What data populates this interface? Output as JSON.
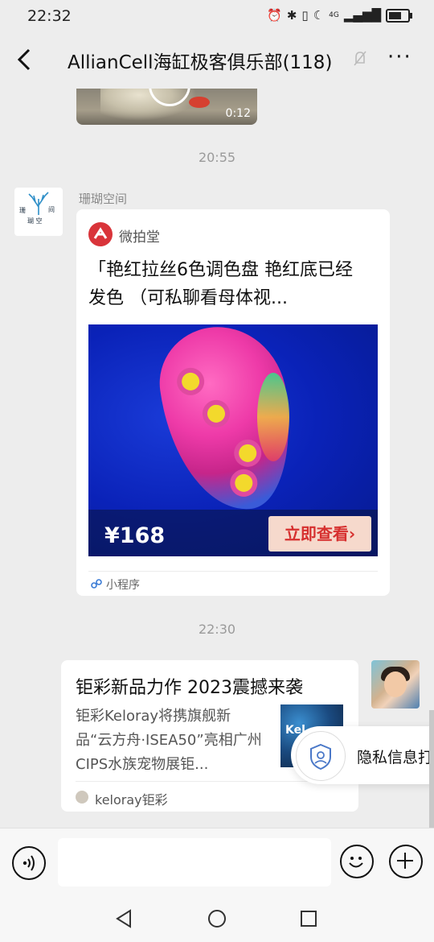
{
  "status_bar": {
    "time": "22:32",
    "network": "4G",
    "icons": [
      "alarm-icon",
      "bluetooth-icon",
      "vibrate-icon",
      "moon-icon",
      "signal-icon",
      "battery-icon"
    ]
  },
  "nav": {
    "title": "AllianCell海缸极客俱乐部(118)",
    "back_icon": "chevron-left-icon",
    "more_label": "···",
    "mute_icon": "bell-slash-icon"
  },
  "messages": {
    "video": {
      "duration": "0:12"
    },
    "timestamp_1": "20:55",
    "card_1": {
      "sender": "珊瑚空间",
      "avatar_text_1": "珊",
      "avatar_text_2": "间",
      "avatar_text_3": "瑚 空",
      "source_name": "微拍堂",
      "title": "「艳红拉丝6色调色盘 艳红底已经发色 （可私聊看母体视...",
      "price": "¥168",
      "cta_label": "立即查看",
      "cta_arrow": "›",
      "footer_label": "小程序"
    },
    "timestamp_2": "22:30",
    "card_2": {
      "title": "钜彩新品力作 2023震撼来袭",
      "description": "钜彩Keloray将携旗舰新品“云方舟·ISEA50”亮相广州CIPS水族宠物展钜...",
      "thumb_text": "Kel",
      "source_label": "keloray钜彩"
    }
  },
  "privacy_toast": {
    "label": "隐私信息打"
  },
  "input_bar": {
    "placeholder": ""
  },
  "colors": {
    "background": "#ededed",
    "card": "#ffffff",
    "accent_red": "#d6302f",
    "mini_program_blue": "#3a7bd5"
  }
}
